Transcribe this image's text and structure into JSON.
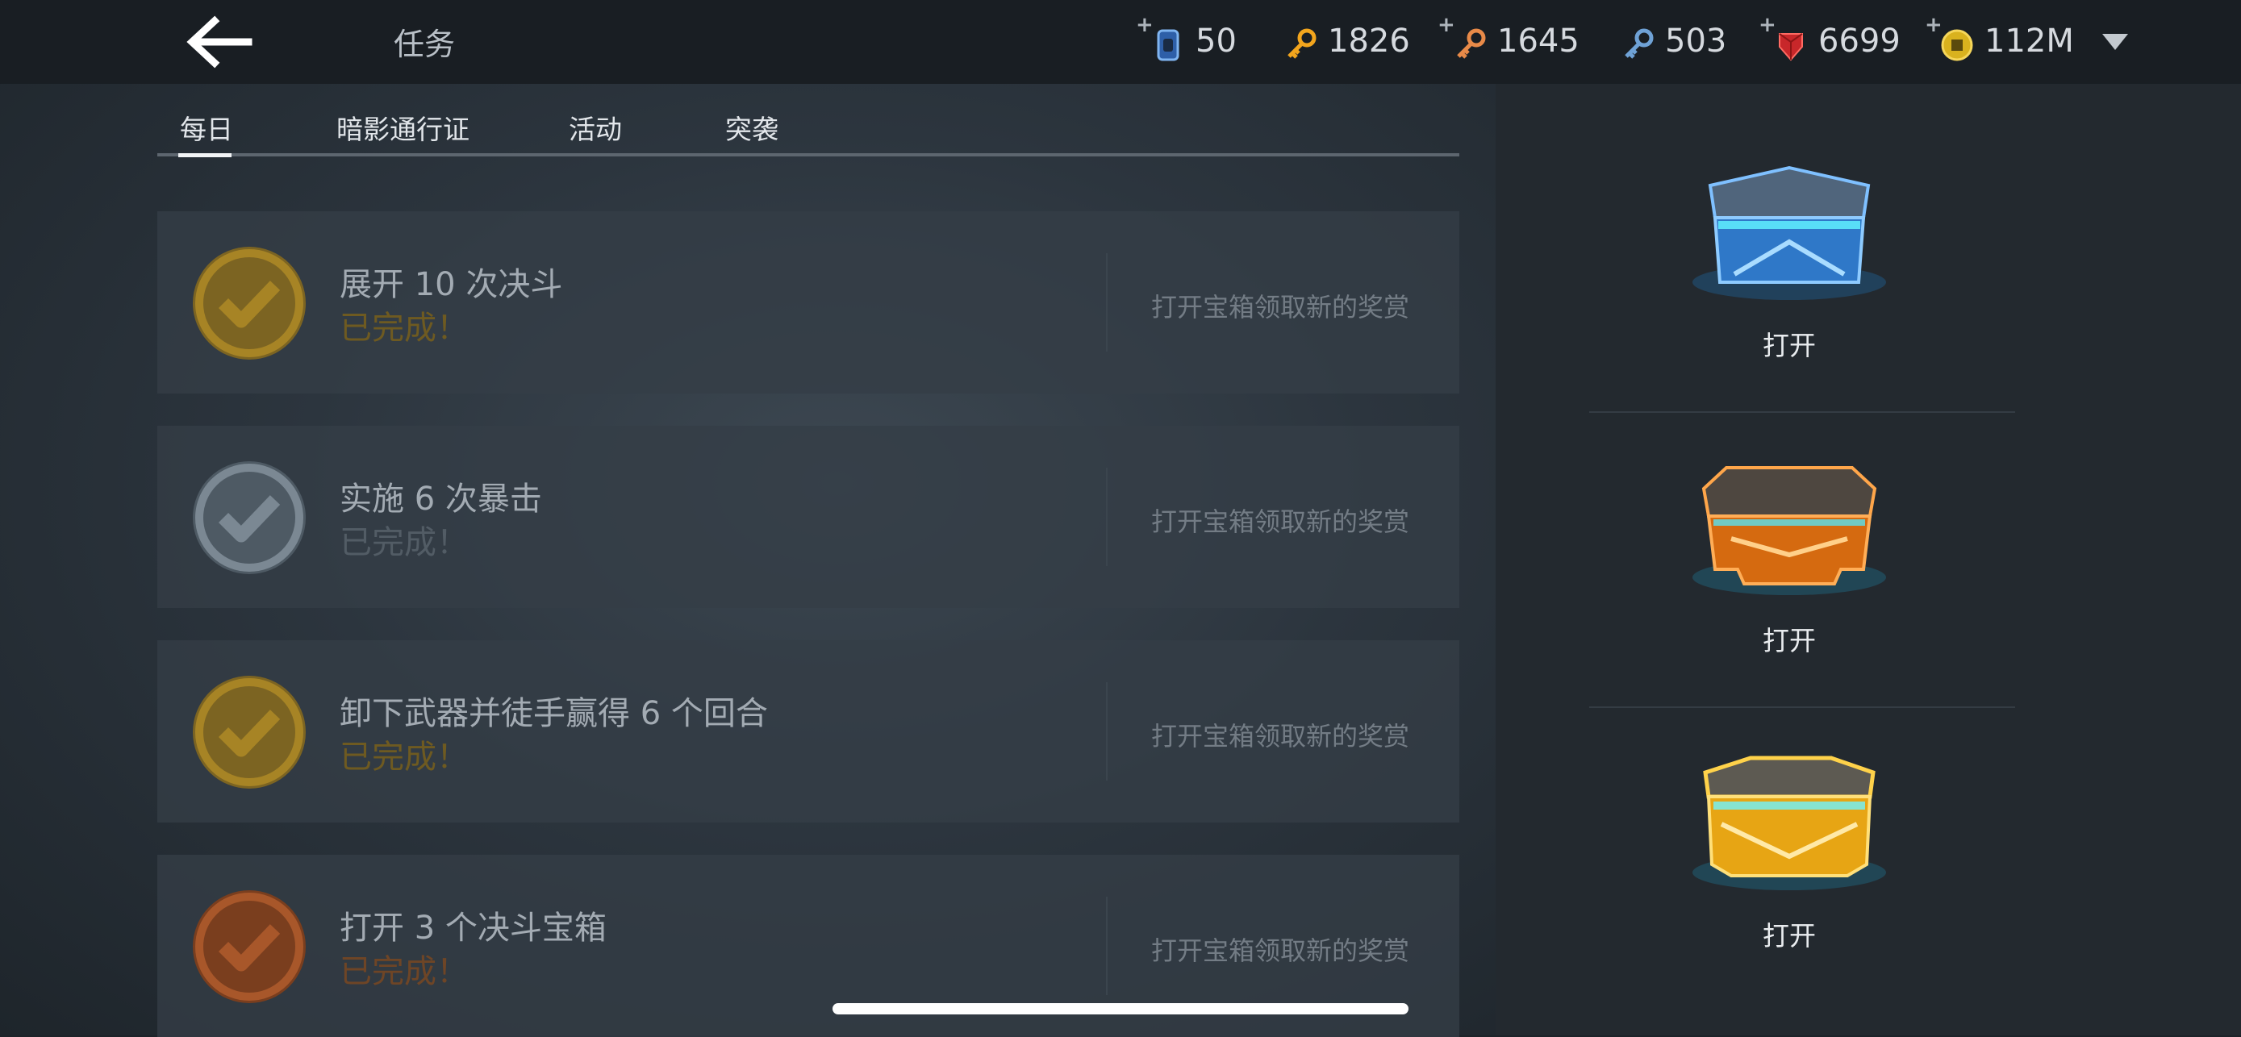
{
  "header": {
    "title": "任务",
    "currencies": [
      {
        "name": "gem-card",
        "value": "50",
        "color": "#4d8fe0"
      },
      {
        "name": "gold-key",
        "value": "1826",
        "color": "#f0a020"
      },
      {
        "name": "orange-key",
        "value": "1645",
        "color": "#e58a46"
      },
      {
        "name": "blue-key",
        "value": "503",
        "color": "#6fa2d6"
      },
      {
        "name": "ruby",
        "value": "6699",
        "color": "#d42a2a"
      },
      {
        "name": "coin",
        "value": "112M",
        "color": "#d9b21e"
      }
    ]
  },
  "tabs": [
    {
      "label": "每日",
      "active": true
    },
    {
      "label": "暗影通行证",
      "active": false
    },
    {
      "label": "活动",
      "active": false
    },
    {
      "label": "突袭",
      "active": false
    }
  ],
  "tasks": [
    {
      "title": "展开 10 次决斗",
      "status": "已完成！",
      "reward_text": "打开宝箱领取新的奖赏",
      "tier": "gold",
      "badge_color": "#a78425",
      "status_color": "#6e5a21"
    },
    {
      "title": "实施 6 次暴击",
      "status": "已完成！",
      "reward_text": "打开宝箱领取新的奖赏",
      "tier": "silver",
      "badge_color": "#7b8893",
      "status_color": "#525c65"
    },
    {
      "title": "卸下武器并徒手赢得 6 个回合",
      "status": "已完成！",
      "reward_text": "打开宝箱领取新的奖赏",
      "tier": "gold",
      "badge_color": "#a78425",
      "status_color": "#6e5a21"
    },
    {
      "title": "打开 3 个决斗宝箱",
      "status": "已完成！",
      "reward_text": "打开宝箱领取新的奖赏",
      "tier": "bronze",
      "badge_color": "#a8572a",
      "status_color": "#6e4526"
    }
  ],
  "chests": [
    {
      "type": "blue-chest",
      "open_label": "打开",
      "color": "#3f84d8"
    },
    {
      "type": "orange-chest",
      "open_label": "打开",
      "color": "#e07214"
    },
    {
      "type": "gold-chest",
      "open_label": "打开",
      "color": "#f0b41a"
    }
  ]
}
